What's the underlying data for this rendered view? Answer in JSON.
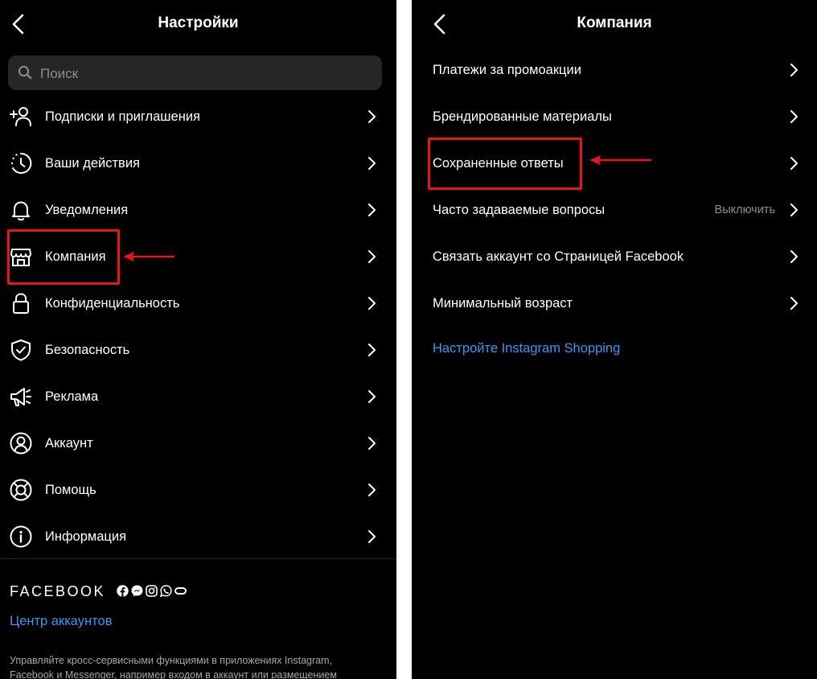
{
  "left": {
    "title": "Настройки",
    "search": {
      "placeholder": "Поиск"
    },
    "items": [
      {
        "label": "Подписки и приглашения",
        "icon": "add-person-icon"
      },
      {
        "label": "Ваши действия",
        "icon": "activity-clock-icon"
      },
      {
        "label": "Уведомления",
        "icon": "bell-icon"
      },
      {
        "label": "Компания",
        "icon": "store-icon"
      },
      {
        "label": "Конфиденциальность",
        "icon": "lock-icon"
      },
      {
        "label": "Безопасность",
        "icon": "shield-check-icon"
      },
      {
        "label": "Реклама",
        "icon": "megaphone-icon"
      },
      {
        "label": "Аккаунт",
        "icon": "account-circle-icon"
      },
      {
        "label": "Помощь",
        "icon": "lifebuoy-icon"
      },
      {
        "label": "Информация",
        "icon": "info-icon"
      }
    ],
    "facebook": {
      "wordmark": "FACEBOOK",
      "icons": [
        "facebook-icon",
        "messenger-icon",
        "instagram-icon",
        "whatsapp-icon",
        "oculus-icon"
      ],
      "accounts_link": "Центр аккаунтов",
      "description": "Управляйте кросс-сервисными функциями в приложениях Instagram, Facebook и Messenger, например входом в аккаунт или размещением"
    }
  },
  "right": {
    "title": "Компания",
    "items": [
      {
        "label": "Платежи за промоакции",
        "value": ""
      },
      {
        "label": "Брендированные материалы",
        "value": ""
      },
      {
        "label": "Сохраненные ответы",
        "value": ""
      },
      {
        "label": "Часто задаваемые вопросы",
        "value": "Выключить"
      },
      {
        "label": "Связать аккаунт со Страницей Facebook",
        "value": ""
      },
      {
        "label": "Минимальный возраст",
        "value": ""
      }
    ],
    "shopping_link": "Настройте Instagram Shopping"
  },
  "colors": {
    "background": "#000000",
    "text": "#ffffff",
    "secondary_text": "#8e8e8e",
    "link": "#3897f0",
    "search_bg": "#262626",
    "highlight": "#e8141b"
  }
}
